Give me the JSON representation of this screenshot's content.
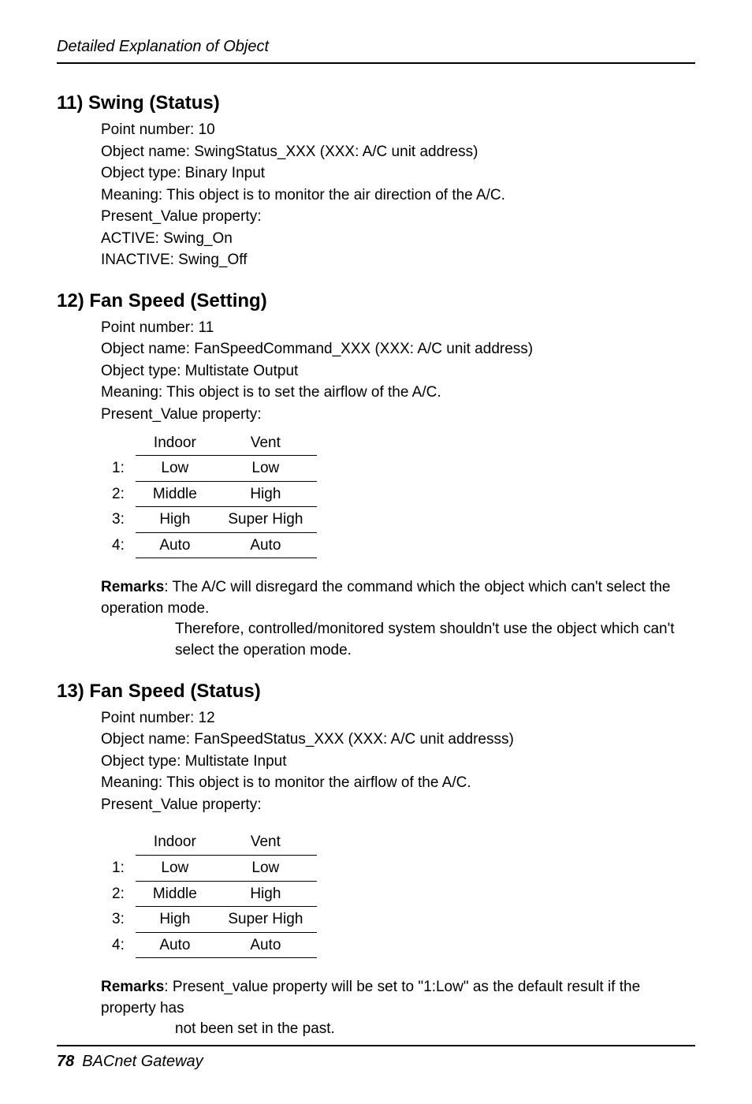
{
  "header": {
    "running_title": "Detailed Explanation of Object"
  },
  "sections": [
    {
      "title": "11) Swing (Status)",
      "lines": [
        "Point number: 10",
        "Object name: SwingStatus_XXX (XXX: A/C unit address)",
        "Object type: Binary Input",
        "Meaning: This object is to monitor the air direction of the A/C.",
        "Present_Value property:",
        "ACTIVE: Swing_On",
        "INACTIVE: Swing_Off"
      ]
    },
    {
      "title": "12) Fan Speed (Setting)",
      "lines": [
        "Point number: 11",
        "Object name: FanSpeedCommand_XXX (XXX: A/C unit address)",
        "Object type: Multistate Output",
        "Meaning: This object is to set the airflow of the A/C.",
        "Present_Value property:"
      ],
      "table": {
        "headers": [
          "",
          "Indoor",
          "Vent"
        ],
        "rows": [
          [
            "1:",
            "Low",
            "Low"
          ],
          [
            "2:",
            "Middle",
            "High"
          ],
          [
            "3:",
            "High",
            "Super High"
          ],
          [
            "4:",
            "Auto",
            "Auto"
          ]
        ]
      },
      "remarks": {
        "label": "Remarks",
        "text": ": The A/C will disregard the command which the object which can't select the operation mode.",
        "cont": "Therefore, controlled/monitored system shouldn't use the object which can't select the operation mode."
      }
    },
    {
      "title": "13) Fan Speed (Status)",
      "lines": [
        "Point number: 12",
        "Object name: FanSpeedStatus_XXX (XXX: A/C unit addresss)",
        "Object type: Multistate Input",
        "Meaning: This object is to monitor the airflow of the A/C.",
        "Present_Value property:"
      ],
      "table": {
        "headers": [
          "",
          "Indoor",
          "Vent"
        ],
        "rows": [
          [
            "1:",
            "Low",
            "Low"
          ],
          [
            "2:",
            "Middle",
            "High"
          ],
          [
            "3:",
            "High",
            "Super High"
          ],
          [
            "4:",
            "Auto",
            "Auto"
          ]
        ]
      },
      "remarks": {
        "label": "Remarks",
        "text": ": Present_value property will be set to \"1:Low\" as the default result if the property has",
        "cont": "not been set in the past."
      }
    }
  ],
  "footer": {
    "page_number": "78",
    "doc_title": "BACnet Gateway"
  }
}
